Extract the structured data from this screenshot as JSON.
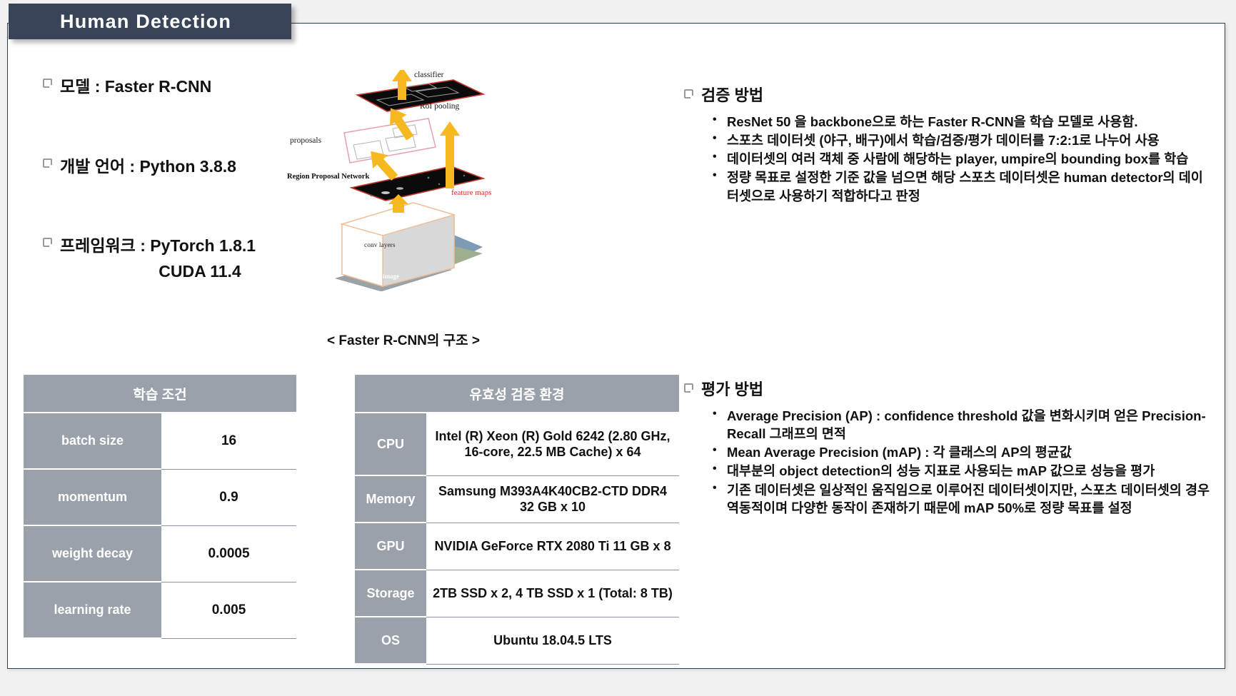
{
  "slide": {
    "title": "Human Detection",
    "accent_dark": "#394458",
    "table_gray": "#9aa1aa"
  },
  "specs": [
    {
      "label": "모델 : Faster R-CNN",
      "sub": ""
    },
    {
      "label": "개발 언어 : Python 3.8.8",
      "sub": ""
    },
    {
      "label": "프레임워크 : PyTorch 1.8.1",
      "sub": "CUDA 11.4"
    }
  ],
  "diagram": {
    "caption": "< Faster R-CNN의 구조 >",
    "labels": {
      "classifier": "classifier",
      "roi_pooling": "RoI pooling",
      "proposals": "proposals",
      "rpn": "Region Proposal Network",
      "feature_maps": "feature maps",
      "conv_layers": "conv layers",
      "image": "image"
    },
    "colors": {
      "arrow": "#F5B81E",
      "plane_edge": "#C0392B",
      "feature_text": "#E03020",
      "box_edge": "#F0BE96"
    }
  },
  "sections": [
    {
      "heading": "검증 방법",
      "bullets": [
        "ResNet 50 을 backbone으로 하는 Faster R-CNN을 학습 모델로 사용함.",
        "스포츠 데이터셋 (야구, 배구)에서 학습/검증/평가 데이터를 7:2:1로 나누어 사용",
        "데이터셋의 여러 객체 중 사람에 해당하는 player, umpire의 bounding box를 학습",
        "정량 목표로 설정한 기준 값을 넘으면 해당 스포츠 데이터셋은 human detector의 데이터셋으로 사용하기 적합하다고 판정"
      ]
    },
    {
      "heading": "평가 방법",
      "bullets": [
        "Average Precision (AP) : confidence threshold 값을 변화시키며 얻은 Precision-Recall 그래프의 면적",
        "Mean Average Precision (mAP) : 각 클래스의 AP의 평균값",
        "대부분의 object detection의 성능 지표로 사용되는 mAP 값으로 성능을 평가",
        "기존 데이터셋은 일상적인 움직임으로 이루어진 데이터셋이지만, 스포츠 데이터셋의 경우 역동적이며 다양한 동작이 존재하기 때문에 mAP 50%로 정량 목표를 설정"
      ]
    }
  ],
  "tables": {
    "training": {
      "title": "학습 조건",
      "rows": [
        {
          "label": "batch size",
          "value": "16"
        },
        {
          "label": "momentum",
          "value": "0.9"
        },
        {
          "label": "weight decay",
          "value": "0.0005"
        },
        {
          "label": "learning rate",
          "value": "0.005"
        }
      ]
    },
    "environment": {
      "title": "유효성 검증 환경",
      "rows": [
        {
          "label": "CPU",
          "value": "Intel (R) Xeon (R) Gold 6242 (2.80 GHz, 16-core, 22.5 MB Cache) x 64"
        },
        {
          "label": "Memory",
          "value": "Samsung M393A4K40CB2-CTD DDR4 32 GB x 10"
        },
        {
          "label": "GPU",
          "value": "NVIDIA  GeForce RTX 2080 Ti 11 GB x 8"
        },
        {
          "label": "Storage",
          "value": "2TB SSD x 2, 4 TB SSD x 1 (Total: 8 TB)"
        },
        {
          "label": "OS",
          "value": "Ubuntu 18.04.5 LTS"
        }
      ]
    }
  }
}
